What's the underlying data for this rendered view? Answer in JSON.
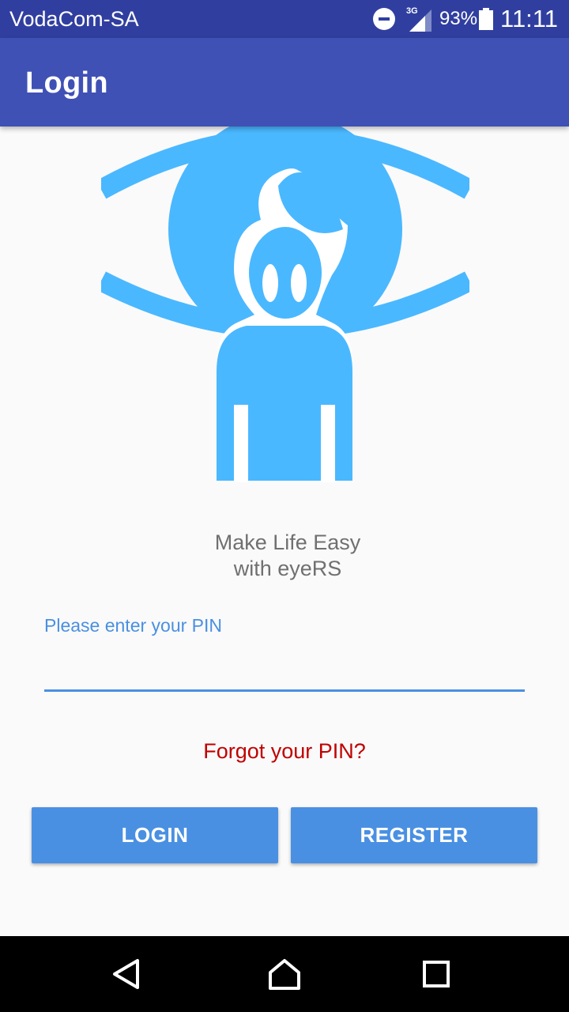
{
  "status_bar": {
    "carrier": "VodaCom-SA",
    "network": "3G",
    "battery": "93%",
    "time": "11:11",
    "icons": [
      "do-not-disturb-icon",
      "signal-icon",
      "battery-icon"
    ]
  },
  "app_bar": {
    "title": "Login"
  },
  "logo": {
    "icon": "eye-person-logo-icon",
    "color": "#4ab8ff"
  },
  "tagline": {
    "line1": "Make Life Easy",
    "line2": "with eyeRS"
  },
  "pin": {
    "label": "Please enter your PIN",
    "value": ""
  },
  "forgot": {
    "label": "Forgot your PIN?"
  },
  "buttons": {
    "login": "LOGIN",
    "register": "REGISTER"
  },
  "nav": {
    "icons": [
      "back-icon",
      "home-icon",
      "recents-icon"
    ]
  },
  "colors": {
    "status_bar": "#303f9f",
    "app_bar": "#3f51b5",
    "accent": "#4a90e2",
    "logo": "#4ab8ff",
    "forgot": "#c00000"
  }
}
